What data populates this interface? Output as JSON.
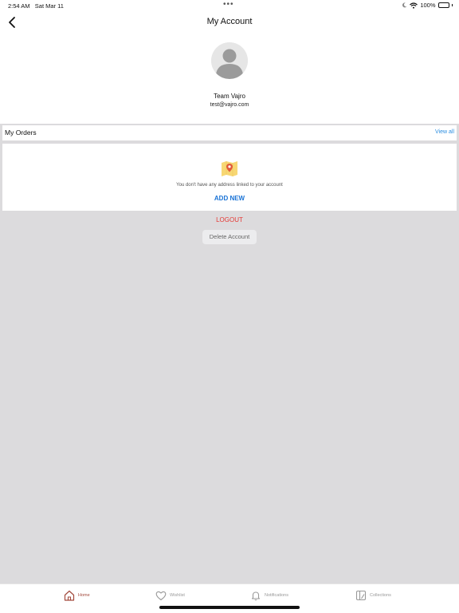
{
  "status_bar": {
    "time": "2:54 AM",
    "date": "Sat Mar 11",
    "multitask_dots": "•••",
    "battery_percent": "100%",
    "battery_level": 1.0
  },
  "nav": {
    "title": "My Account"
  },
  "profile": {
    "name": "Team Vajro",
    "email": "test@vajro.com"
  },
  "orders": {
    "title": "My Orders",
    "view_all_label": "View all"
  },
  "address": {
    "empty_message": "You don't have any address linked to your account",
    "add_new_label": "ADD NEW"
  },
  "actions": {
    "logout_label": "LOGOUT",
    "delete_account_label": "Delete Account"
  },
  "tab_bar": {
    "items": [
      {
        "label": "Home",
        "icon": "home-icon",
        "active": true
      },
      {
        "label": "Wishlist",
        "icon": "heart-icon",
        "active": false
      },
      {
        "label": "Notifications",
        "icon": "bell-icon",
        "active": false
      },
      {
        "label": "Collections",
        "icon": "collections-icon",
        "active": false
      }
    ]
  },
  "colors": {
    "accent_blue": "#1a73d6",
    "logout_red": "#e53935",
    "active_tab": "#a34a3d",
    "background": "#dcdbdd"
  }
}
